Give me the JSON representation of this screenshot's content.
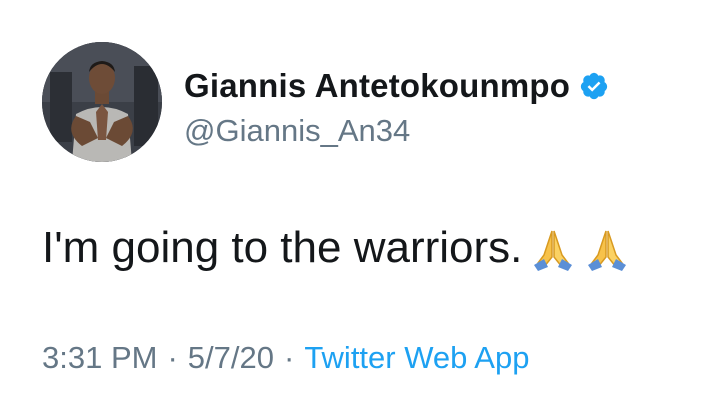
{
  "user": {
    "display_name": "Giannis Antetokounmpo",
    "handle": "@Giannis_An34",
    "verified": true,
    "verified_color": "#1da1f2",
    "avatar_icon": "profile-photo"
  },
  "tweet": {
    "text": "I'm going to the warriors.",
    "emojis": [
      "folded-hands-emoji",
      "folded-hands-emoji"
    ]
  },
  "meta": {
    "time": "3:31 PM",
    "separator": "·",
    "date": "5/7/20",
    "source": "Twitter Web App"
  },
  "colors": {
    "primary_text": "#14171a",
    "secondary_text": "#657786",
    "link": "#1da1f2"
  }
}
